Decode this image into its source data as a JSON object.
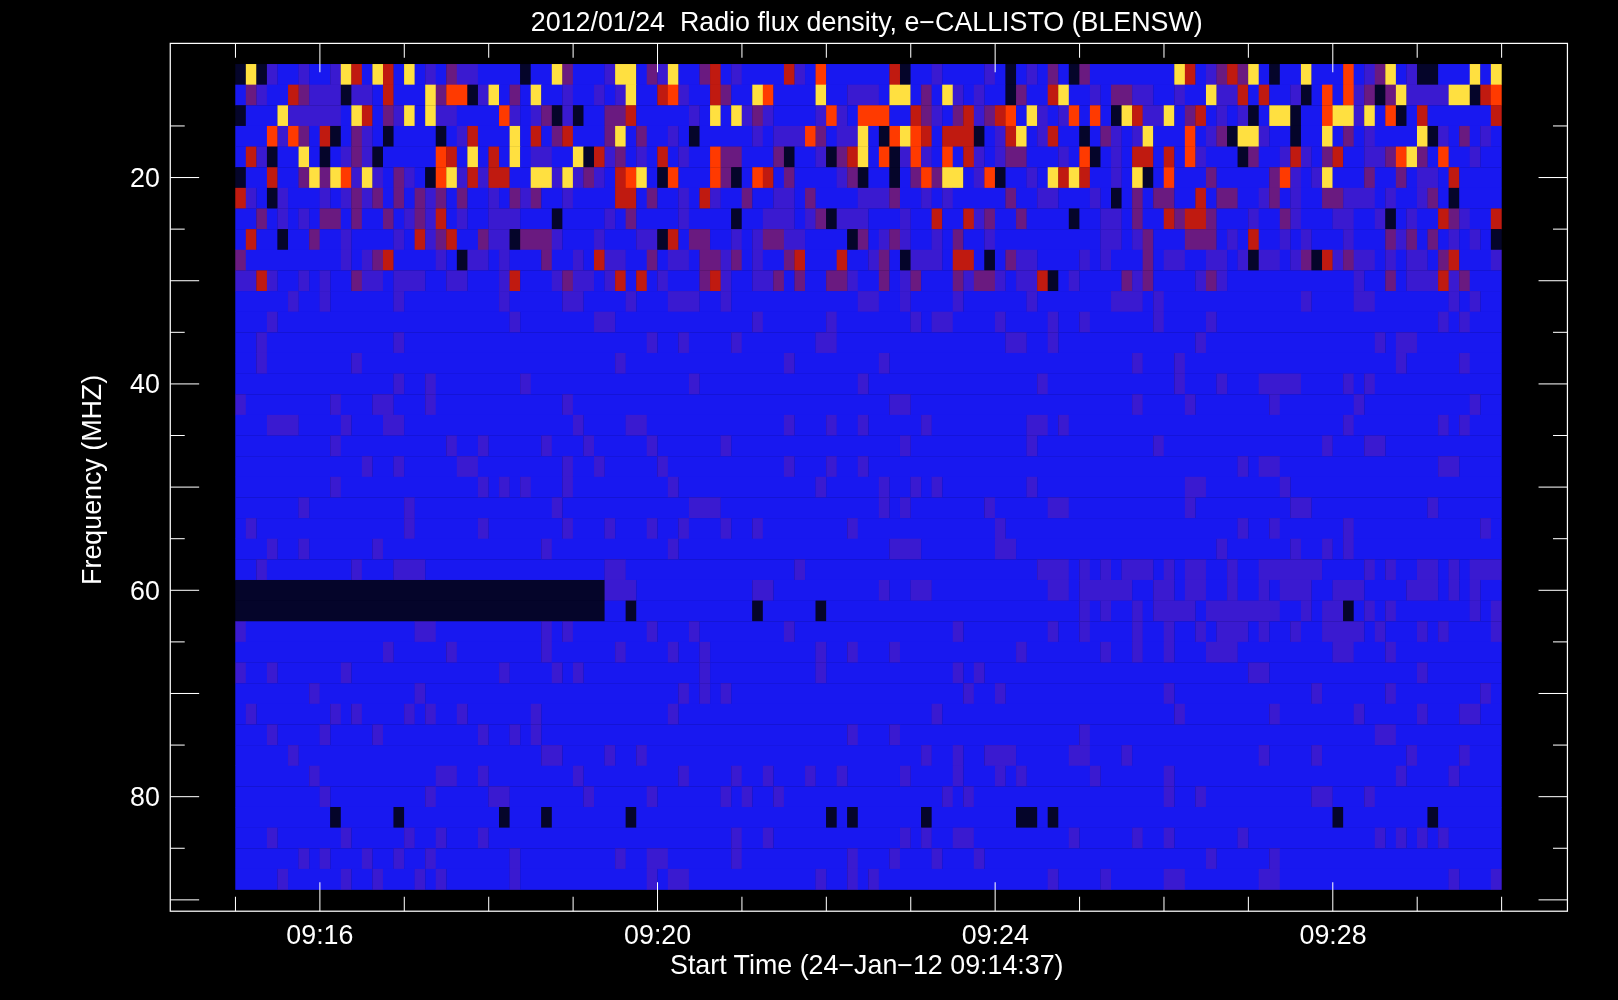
{
  "title": "2012/01/24  Radio flux density, e−CALLISTO (BLENSW)",
  "plot": {
    "xlabel": "Start Time (24−Jan−12 09:14:37)",
    "ylabel": "Frequency (MHZ)",
    "xticks": [
      "09:16",
      "09:20",
      "09:24",
      "09:28"
    ],
    "yticks": [
      "20",
      "40",
      "60",
      "80"
    ]
  }
}
